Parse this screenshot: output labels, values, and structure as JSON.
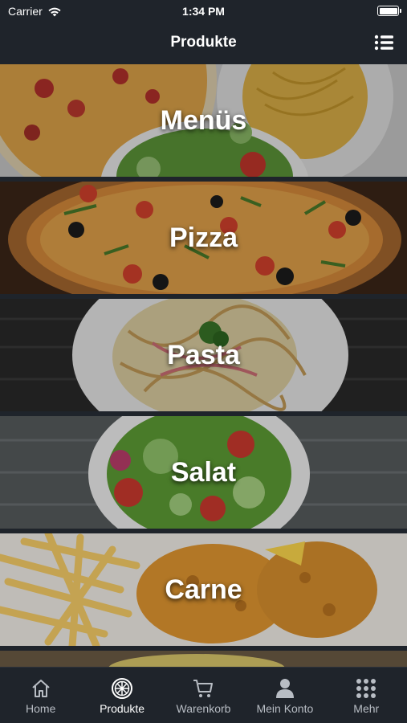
{
  "status_bar": {
    "carrier": "Carrier",
    "time": "1:34 PM"
  },
  "nav": {
    "title": "Produkte",
    "menu_icon": "list-icon"
  },
  "categories": [
    {
      "label": "Menüs"
    },
    {
      "label": "Pizza"
    },
    {
      "label": "Pasta"
    },
    {
      "label": "Salat"
    },
    {
      "label": "Carne"
    }
  ],
  "tabs": [
    {
      "label": "Home",
      "icon": "home-icon",
      "active": false
    },
    {
      "label": "Produkte",
      "icon": "pizza-icon",
      "active": true
    },
    {
      "label": "Warenkorb",
      "icon": "cart-icon",
      "active": false
    },
    {
      "label": "Mein Konto",
      "icon": "user-icon",
      "active": false
    },
    {
      "label": "Mehr",
      "icon": "grid-icon",
      "active": false
    }
  ],
  "colors": {
    "bar_background": "#1f242b",
    "tab_active": "#ffffff",
    "tab_inactive": "#b8bdc4"
  }
}
